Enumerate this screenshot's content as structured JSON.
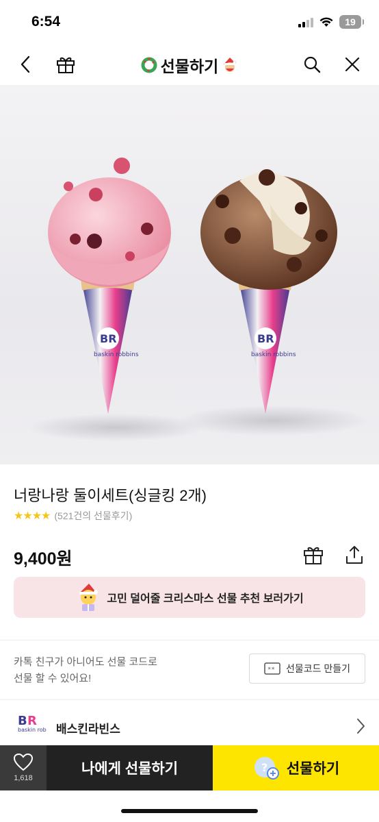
{
  "status": {
    "time": "6:54",
    "battery": "19"
  },
  "nav": {
    "title": "선물하기",
    "icons": [
      "back-icon",
      "gift-box-icon",
      "search-icon",
      "close-icon"
    ]
  },
  "product": {
    "title": "너랑나랑 둘이세트(싱글킹 2개)",
    "stars": "★★★★",
    "reviews": "(521건의 선물후기)",
    "price": "9,400원",
    "image_logo_text": "baskin robbins"
  },
  "banner": {
    "text": "고민 덜어줄 크리스마스 선물 추천 보러가기"
  },
  "gift_code": {
    "description_line1": "카톡 친구가 아니어도 선물 코드로",
    "description_line2": "선물 할 수 있어요!",
    "button_label": "선물코드 만들기"
  },
  "brand": {
    "name": "배스킨라빈스",
    "logo_text": "baskin robbins"
  },
  "bottom": {
    "like_count": "1,618",
    "gift_self_label": "나에게 선물하기",
    "gift_label": "선물하기"
  },
  "colors": {
    "accent_yellow": "#fee500",
    "dark": "#222222",
    "banner_pink": "#f8e4e6",
    "star": "#f5c518"
  }
}
